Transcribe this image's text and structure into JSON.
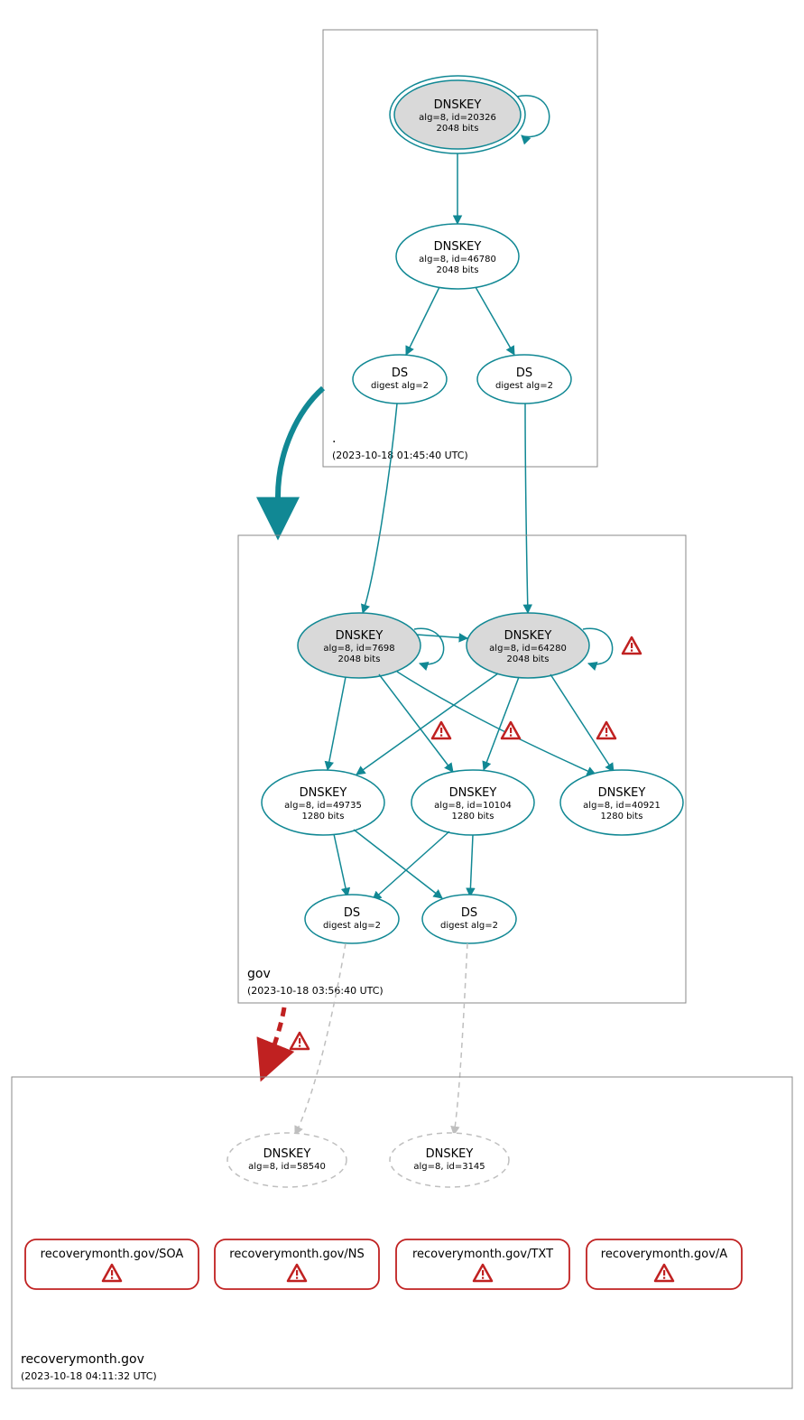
{
  "zones": {
    "root": {
      "label": ".",
      "timestamp": "(2023-10-18 01:45:40 UTC)"
    },
    "gov": {
      "label": "gov",
      "timestamp": "(2023-10-18 03:56:40 UTC)"
    },
    "recoverymonth": {
      "label": "recoverymonth.gov",
      "timestamp": "(2023-10-18 04:11:32 UTC)"
    }
  },
  "nodes": {
    "root_ksk": {
      "title": "DNSKEY",
      "line2": "alg=8, id=20326",
      "line3": "2048 bits"
    },
    "root_zsk": {
      "title": "DNSKEY",
      "line2": "alg=8, id=46780",
      "line3": "2048 bits"
    },
    "root_ds1": {
      "title": "DS",
      "line2": "digest alg=2"
    },
    "root_ds2": {
      "title": "DS",
      "line2": "digest alg=2"
    },
    "gov_k7698": {
      "title": "DNSKEY",
      "line2": "alg=8, id=7698",
      "line3": "2048 bits"
    },
    "gov_k64280": {
      "title": "DNSKEY",
      "line2": "alg=8, id=64280",
      "line3": "2048 bits"
    },
    "gov_k49735": {
      "title": "DNSKEY",
      "line2": "alg=8, id=49735",
      "line3": "1280 bits"
    },
    "gov_k10104": {
      "title": "DNSKEY",
      "line2": "alg=8, id=10104",
      "line3": "1280 bits"
    },
    "gov_k40921": {
      "title": "DNSKEY",
      "line2": "alg=8, id=40921",
      "line3": "1280 bits"
    },
    "gov_ds1": {
      "title": "DS",
      "line2": "digest alg=2"
    },
    "gov_ds2": {
      "title": "DS",
      "line2": "digest alg=2"
    },
    "rm_k58540": {
      "title": "DNSKEY",
      "line2": "alg=8, id=58540"
    },
    "rm_k3145": {
      "title": "DNSKEY",
      "line2": "alg=8, id=3145"
    }
  },
  "rr": {
    "soa": "recoverymonth.gov/SOA",
    "ns": "recoverymonth.gov/NS",
    "txt": "recoverymonth.gov/TXT",
    "a": "recoverymonth.gov/A"
  },
  "colors": {
    "teal": "#118894",
    "red": "#c02121",
    "gray": "#bfbfbf",
    "boxgray": "#888888",
    "fillgray": "#d9d9d9"
  }
}
